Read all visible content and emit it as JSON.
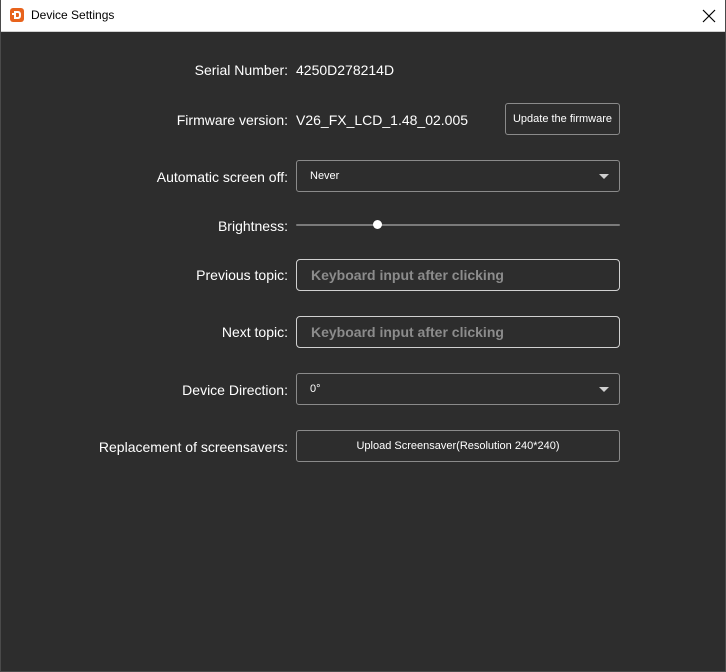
{
  "window": {
    "title": "Device Settings"
  },
  "serial": {
    "label": "Serial Number:",
    "value": "4250D278214D"
  },
  "firmware": {
    "label": "Firmware version:",
    "value": "V26_FX_LCD_1.48_02.005",
    "update_button": "Update the firmware"
  },
  "screen_off": {
    "label": "Automatic screen off:",
    "selected": "Never"
  },
  "brightness": {
    "label": "Brightness:",
    "level_fraction": 0.25
  },
  "previous_topic": {
    "label": "Previous topic:",
    "placeholder": "Keyboard input after clicking"
  },
  "next_topic": {
    "label": "Next topic:",
    "placeholder": "Keyboard input after clicking"
  },
  "direction": {
    "label": "Device Direction:",
    "selected": "0°"
  },
  "screensaver": {
    "label": "Replacement of screensavers:",
    "upload_button": "Upload Screensaver(Resolution 240*240)"
  },
  "colors": {
    "background": "#2d2d2d",
    "titlebar": "#ffffff",
    "accent_icon": "#e8631c"
  },
  "icons": {
    "app": "app-logo-icon",
    "close": "close-icon",
    "dropdown": "chevron-down-icon"
  }
}
